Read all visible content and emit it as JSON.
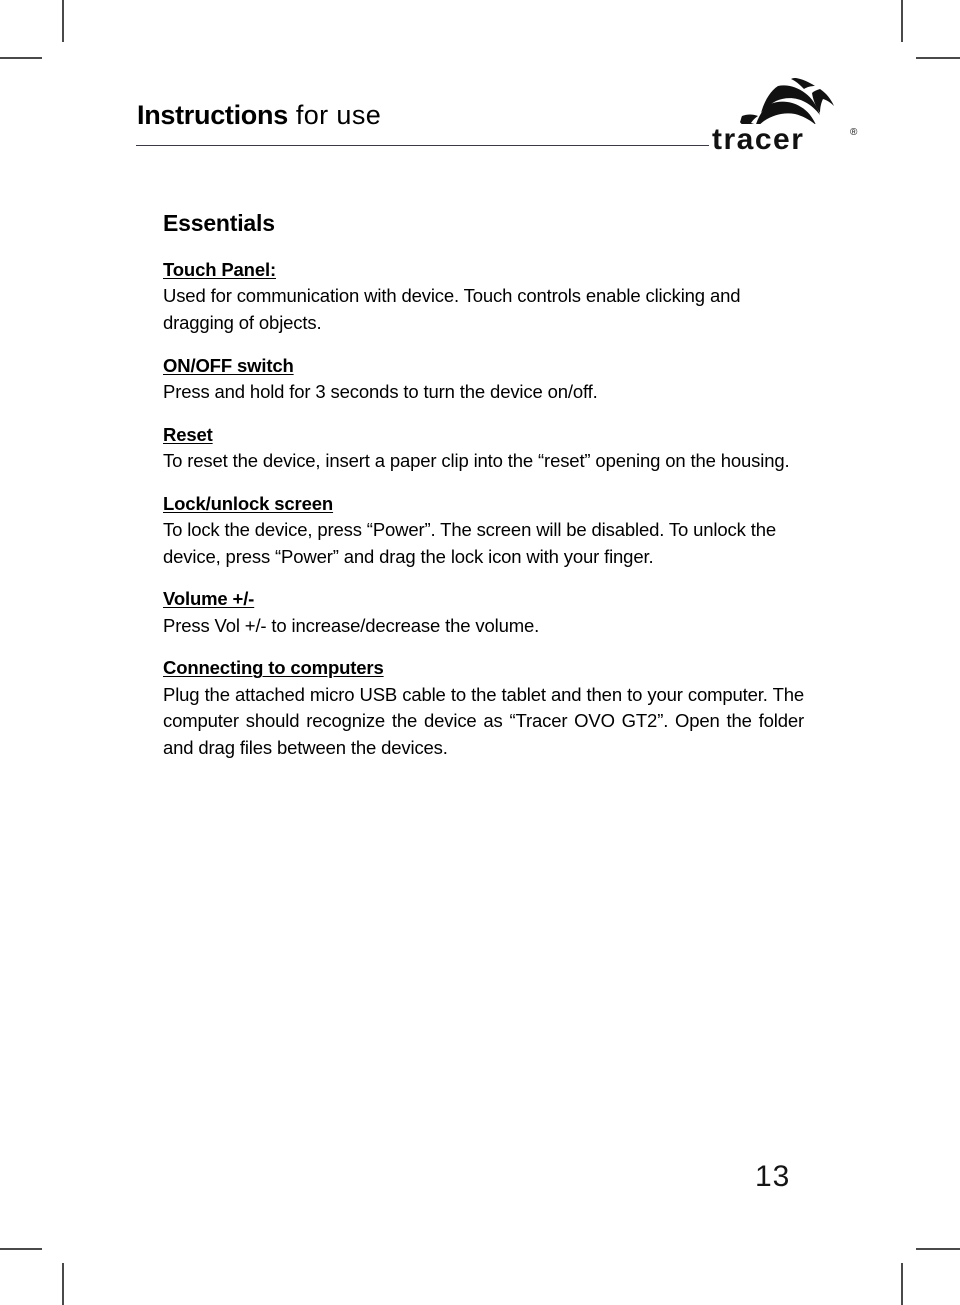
{
  "header": {
    "title_bold": "Instructions",
    "title_light": " for use",
    "logo_wordmark": "tracer",
    "logo_trademark": "®"
  },
  "content": {
    "section_title": "Essentials",
    "blocks": [
      {
        "heading": "Touch Panel:",
        "body": "Used for communication with device. Touch controls enable clicking and dragging of objects."
      },
      {
        "heading": "ON/OFF switch",
        "body": "Press and hold for 3 seconds to turn the device on/off."
      },
      {
        "heading": "Reset",
        "body": "To reset the device, insert a paper clip into the “reset” opening on the housing."
      },
      {
        "heading": "Lock/unlock screen",
        "body": "To lock the device, press “Power”. The screen will be disabled. To unlock the device, press “Power” and drag the lock icon with your finger."
      },
      {
        "heading": "Volume +/-",
        "body": "Press Vol +/- to increase/decrease the volume."
      },
      {
        "heading": "Connecting to computers",
        "body": "Plug the attached micro USB cable to the tablet and then to your computer. The computer should recognize the device as “Tracer OVO GT2”. Open the folder and drag files between the devices."
      }
    ]
  },
  "footer": {
    "page_number": "13"
  },
  "colors": {
    "text": "#000000",
    "rule": "#3a3a44",
    "crop_mark": "#4a4a4a"
  }
}
